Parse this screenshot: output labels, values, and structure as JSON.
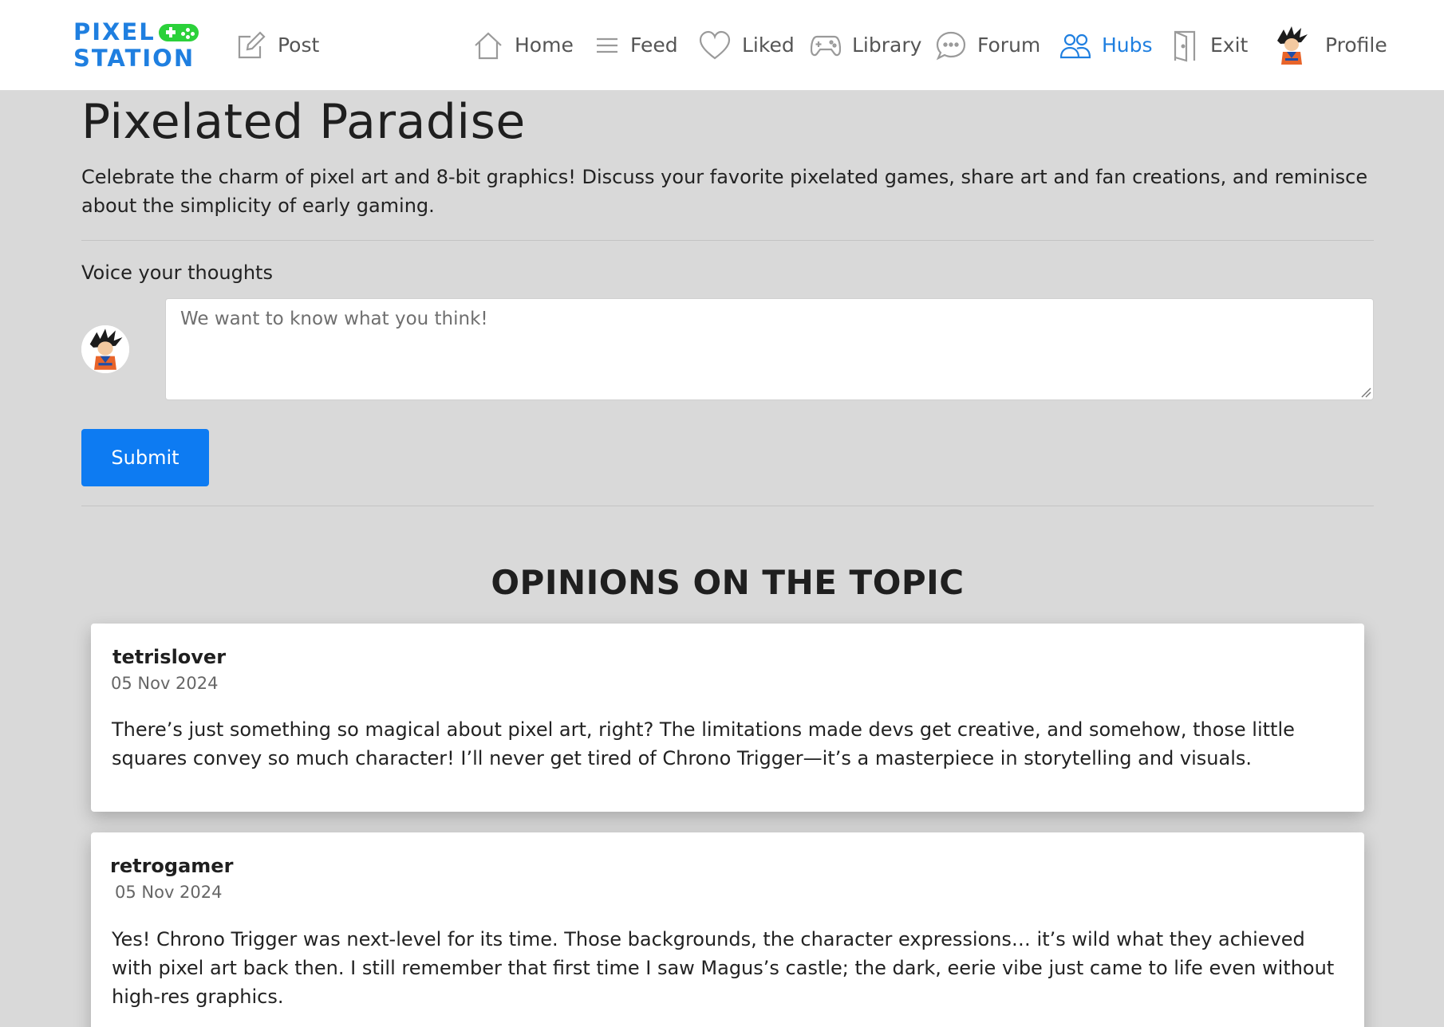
{
  "brand": {
    "line1": "PIXEL",
    "line2": "STATION",
    "accent": "#1f7fe0",
    "gamepad_color": "#2bd13a"
  },
  "nav": {
    "post": "Post",
    "home": "Home",
    "feed": "Feed",
    "liked": "Liked",
    "library": "Library",
    "forum": "Forum",
    "hubs": "Hubs",
    "exit": "Exit",
    "profile": "Profile",
    "active": "hubs",
    "active_color": "#1f7fe0"
  },
  "topic": {
    "title": "Pixelated Paradise",
    "description": "Celebrate the charm of pixel art and 8-bit graphics! Discuss your favorite pixelated games, share art and fan creations, and reminisce about the simplicity of early gaming."
  },
  "compose": {
    "label": "Voice your thoughts",
    "placeholder": "We want to know what you think!",
    "value": "",
    "submit_label": "Submit",
    "submit_color": "#0d7bf2"
  },
  "opinions": {
    "heading": "OPINIONS ON THE TOPIC",
    "items": [
      {
        "author": "tetrislover",
        "date": "05 Nov 2024",
        "text": "There’s just something so magical about pixel art, right? The limitations made devs get creative, and somehow, those little squares convey so much character! I’ll never get tired of Chrono Trigger—it’s a masterpiece in storytelling and visuals."
      },
      {
        "author": "retrogamer",
        "date": "05 Nov 2024",
        "text": "Yes! Chrono Trigger was next-level for its time. Those backgrounds, the character expressions… it’s wild what they achieved with pixel art back then. I still remember that first time I saw Magus’s castle; the dark, eerie vibe just came to life even without high-res graphics."
      }
    ]
  }
}
